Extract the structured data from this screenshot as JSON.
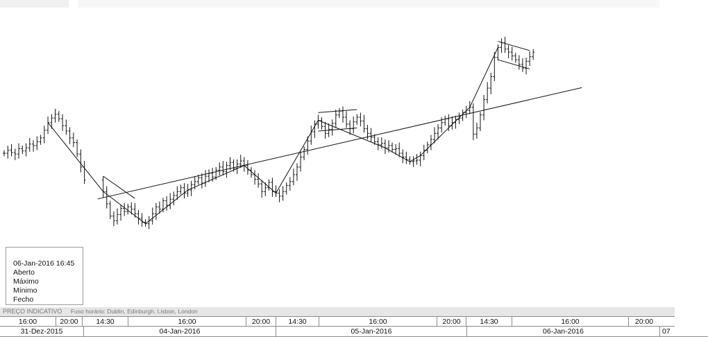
{
  "info": {
    "datetime": "06-Jan-2016 16:45",
    "open_label": "Aberto",
    "high_label": "Máximo",
    "low_label": "Mínimo",
    "close_label": "Fecho"
  },
  "footer": {
    "mode": "PREÇO INDICATIVO",
    "timezone": "Fuso horário: Dublin, Edinburgh, Lisbon, London"
  },
  "time_axis": {
    "times": [
      "16:00",
      "20:00",
      "14:30",
      "16:00",
      "20:00",
      "14:30",
      "16:00",
      "20:00",
      "14:30",
      "16:00",
      "20:00"
    ],
    "dates": [
      "31-Dez-2015",
      "04-Jan-2016",
      "05-Jan-2016",
      "06-Jan-2016",
      "07"
    ]
  },
  "chart_data": {
    "type": "line",
    "title": "",
    "xlabel": "",
    "ylabel": "",
    "y_axis_visible": false,
    "series": [
      {
        "values": [
          200,
          204,
          201,
          199,
          206,
          203,
          207,
          212,
          210,
          215,
          220,
          230,
          240,
          246,
          251,
          245,
          236,
          229,
          220,
          214,
          199,
          182,
          165,
          150,
          134,
          118,
          112,
          120,
          128,
          124,
          130,
          127,
          121,
          115,
          110,
          108,
          112,
          121,
          130,
          127,
          138,
          132,
          140,
          145,
          150,
          155,
          148,
          152,
          159,
          163,
          168,
          161,
          170,
          174,
          169,
          178,
          182,
          176,
          184,
          188,
          180,
          186,
          190,
          184,
          178,
          172,
          166,
          160,
          150,
          155,
          162,
          150,
          148,
          144,
          150,
          158,
          163,
          172,
          182,
          195,
          205,
          216,
          228,
          238,
          243,
          235,
          226,
          231,
          239,
          250,
          255,
          247,
          238,
          232,
          241,
          247,
          242,
          232,
          226,
          221,
          215,
          211,
          213,
          207,
          210,
          205,
          206,
          200,
          195,
          192,
          189,
          190,
          191,
          197,
          204,
          211,
          218,
          226,
          233,
          240,
          245,
          236,
          240,
          244,
          246,
          253,
          256,
          260,
          225,
          233,
          250,
          270,
          285,
          300,
          325,
          338,
          344,
          336,
          332,
          327,
          322,
          316,
          311,
          320,
          326,
          332
        ]
      }
    ],
    "annotations": [
      {
        "type": "trendline",
        "points": [
          [
            22,
            108
          ],
          [
            142,
            248
          ]
        ]
      },
      {
        "type": "trendline",
        "points": [
          [
            22,
            108
          ],
          [
            2,
            155
          ]
        ]
      },
      {
        "type": "trendline",
        "points": [
          [
            89,
            170
          ],
          [
            126,
            250
          ]
        ]
      },
      {
        "type": "trendline",
        "points": [
          [
            2,
            155
          ],
          [
            22,
            100
          ]
        ]
      }
    ]
  }
}
